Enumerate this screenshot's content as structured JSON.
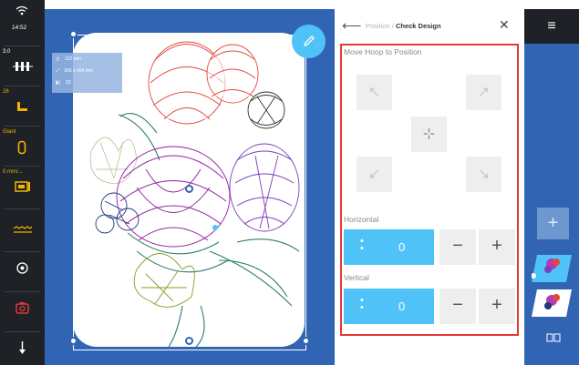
{
  "status": {
    "time": "14:52",
    "tension_value": "3.0",
    "speed_value": "26",
    "presser_label": "Giant",
    "feed_label": "0 mm/..."
  },
  "canvas": {
    "info": {
      "position": "122 mm",
      "size": "305 x 404 mm",
      "stitches": "33"
    }
  },
  "panel": {
    "breadcrumb_parent": "Position",
    "breadcrumb_sep": " / ",
    "breadcrumb_current": "Check Design",
    "move_title": "Move Hoop to Position",
    "arrows": {
      "up_left": "↖",
      "up_right": "↗",
      "center": "⊹",
      "down_left": "↙",
      "down_right": "↘"
    },
    "horizontal": {
      "label": "Horizontal",
      "value": "0",
      "minus": "−",
      "plus": "+"
    },
    "vertical": {
      "label": "Vertical",
      "value": "0",
      "minus": "−",
      "plus": "+"
    }
  },
  "right": {
    "add": "+",
    "menu": "≡"
  },
  "colors": {
    "canvas_blue": "#3165b4",
    "accent_cyan": "#4fc3f7",
    "highlight_red": "#e53935",
    "dark_bar": "#1e2126",
    "icon_yellow": "#f5b400"
  }
}
